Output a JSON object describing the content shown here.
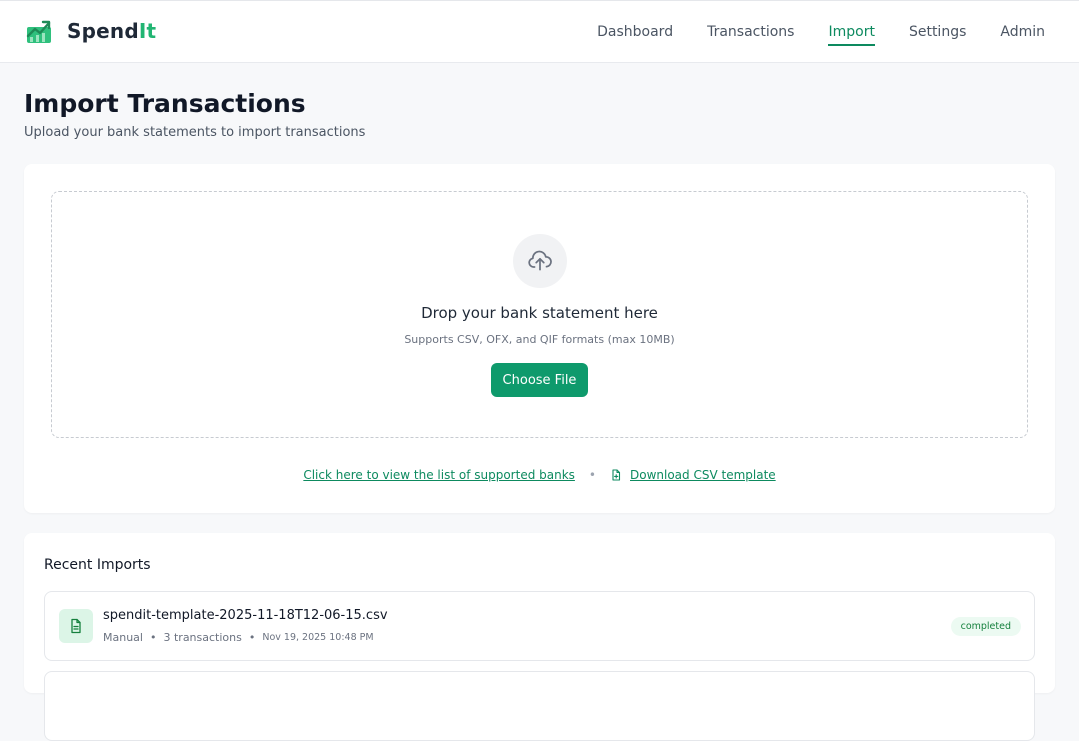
{
  "app": {
    "name_main": "Spend",
    "name_accent": "It",
    "logo_icon": "trending-chart-icon",
    "brand_color": "#22b573"
  },
  "nav": {
    "items": [
      {
        "label": "Dashboard",
        "active": false
      },
      {
        "label": "Transactions",
        "active": false
      },
      {
        "label": "Import",
        "active": true
      },
      {
        "label": "Settings",
        "active": false
      },
      {
        "label": "Admin",
        "active": false
      }
    ]
  },
  "page": {
    "title": "Import Transactions",
    "subtitle": "Upload your bank statements to import transactions"
  },
  "upload": {
    "icon": "cloud-upload-icon",
    "title": "Drop your bank statement here",
    "subtitle": "Supports CSV, OFX, and QIF formats (max 10MB)",
    "button_label": "Choose File",
    "supported_banks_link": "Click here to view the list of supported banks",
    "separator": "•",
    "template_link": "Download CSV template",
    "accent_color": "#0e9a6c"
  },
  "recent": {
    "title": "Recent Imports",
    "items": [
      {
        "file_name": "spendit-template-2025-11-18T12-06-15.csv",
        "source": "Manual",
        "count": "3 transactions",
        "date": "Nov 19, 2025 10:48 PM",
        "status": "completed",
        "separator": "•"
      }
    ]
  }
}
